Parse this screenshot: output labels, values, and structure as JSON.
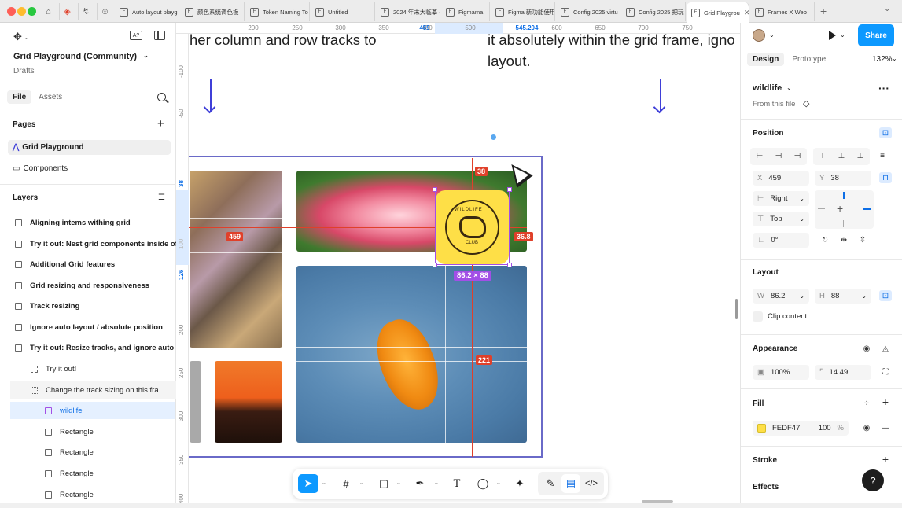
{
  "browser": {
    "tabs": [
      {
        "label": "Auto layout playg"
      },
      {
        "label": "颜色系统调色板"
      },
      {
        "label": "Token Naming To"
      },
      {
        "label": "Untitled"
      },
      {
        "label": "2024 年末大临摹 -"
      },
      {
        "label": "Figmama"
      },
      {
        "label": "Figma 新功能使用"
      },
      {
        "label": "Config 2025 virtu"
      },
      {
        "label": "Config 2025 把玩"
      },
      {
        "label": "Grid Playgrou",
        "active": true
      },
      {
        "label": "Frames X Web"
      }
    ]
  },
  "left_panel": {
    "ai_badge": "A?",
    "file_title": "Grid Playground (Community)",
    "file_location": "Drafts",
    "tabs": [
      "File",
      "Assets"
    ],
    "pages_heading": "Pages",
    "pages": [
      {
        "label": "Grid Playground",
        "selected": true
      },
      {
        "label": "Components",
        "selected": false
      }
    ],
    "layers_heading": "Layers",
    "layers": [
      {
        "label": "Aligning intems withing grid",
        "bold": true
      },
      {
        "label": "Try it out: Nest grid components inside of",
        "bold": true
      },
      {
        "label": "Additional Grid features",
        "bold": true
      },
      {
        "label": "Grid resizing and responsiveness",
        "bold": true
      },
      {
        "label": "Track resizing",
        "bold": true
      },
      {
        "label": "Ignore auto layout / absolute position",
        "bold": true
      },
      {
        "label": "Try it out: Resize tracks, and ignore auto la",
        "bold": true
      },
      {
        "label": "Try it out!",
        "bold": false
      },
      {
        "label": "Change the track sizing on this fra...",
        "bold": false
      },
      {
        "label": "wildlife",
        "bold": false,
        "selected": true
      },
      {
        "label": "Rectangle",
        "bold": false
      },
      {
        "label": "Rectangle",
        "bold": false
      },
      {
        "label": "Rectangle",
        "bold": false
      },
      {
        "label": "Rectangle",
        "bold": false
      }
    ]
  },
  "rulers": {
    "top": [
      {
        "label": "200"
      },
      {
        "label": "250"
      },
      {
        "label": "300"
      },
      {
        "label": "350"
      },
      {
        "label": "400"
      },
      {
        "label": "459",
        "highlight": true
      },
      {
        "label": "500"
      },
      {
        "label": "545.204",
        "highlight": true
      },
      {
        "label": "600"
      },
      {
        "label": "650"
      },
      {
        "label": "700"
      },
      {
        "label": "750"
      }
    ],
    "left": [
      {
        "label": "-100"
      },
      {
        "label": "-50"
      },
      {
        "label": "38",
        "highlight": true
      },
      {
        "label": "100"
      },
      {
        "label": "126",
        "highlight": true
      },
      {
        "label": "200"
      },
      {
        "label": "250"
      },
      {
        "label": "300"
      },
      {
        "label": "350"
      },
      {
        "label": "400"
      }
    ]
  },
  "canvas": {
    "text_left": "her column and row tracks to",
    "text_right_1": "it absolutely within the grid frame, igno",
    "text_right_2": "layout.",
    "measure_top": "38",
    "measure_left": "459",
    "measure_right": "36.8",
    "measure_bottom": "221",
    "size_label": "86.2 × 88",
    "sticker_text_top": "WILDLIFE",
    "sticker_text_bottom": "CLUB"
  },
  "right_panel": {
    "share_label": "Share",
    "tabs": [
      "Design",
      "Prototype"
    ],
    "zoom": "132%",
    "component_name": "wildlife",
    "component_source": "From this file",
    "position_heading": "Position",
    "x_label": "X",
    "x_value": "459",
    "y_label": "Y",
    "y_value": "38",
    "h_constraint": "Right",
    "v_constraint": "Top",
    "rotation": "0°",
    "layout_heading": "Layout",
    "w_label": "W",
    "w_value": "86.2",
    "h_label": "H",
    "h_value": "88",
    "clip_content": "Clip content",
    "appearance_heading": "Appearance",
    "opacity": "100%",
    "corner_radius": "14.49",
    "fill_heading": "Fill",
    "fill_hex": "FEDF47",
    "fill_opacity": "100",
    "fill_opacity_unit": "%",
    "stroke_heading": "Stroke",
    "effects_heading": "Effects",
    "help": "?"
  },
  "colors": {
    "accent": "#0d99ff",
    "selection": "#a24fe6",
    "measure": "#e0402a",
    "fill": "#fedf47"
  }
}
